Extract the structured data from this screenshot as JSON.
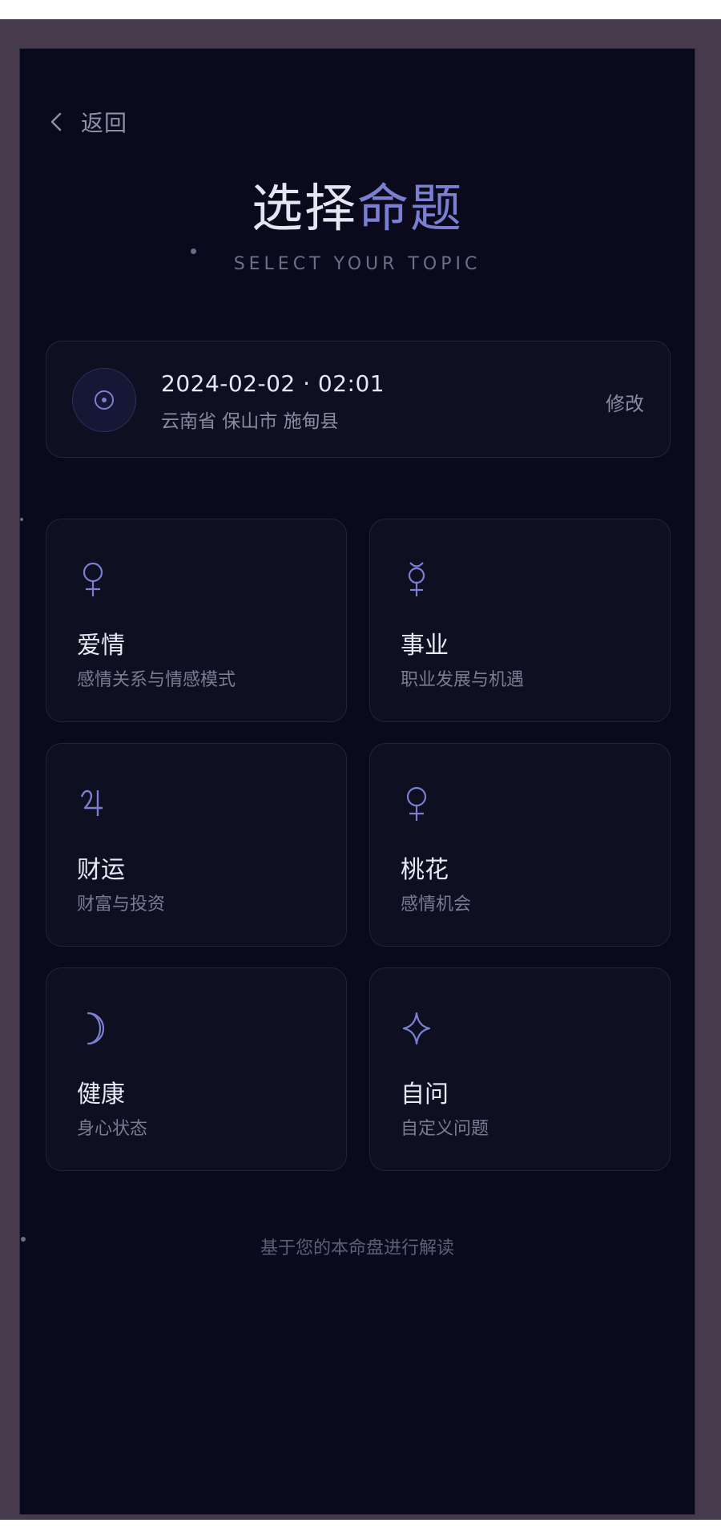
{
  "header": {
    "back_label": "返回"
  },
  "title": {
    "main": "选择",
    "accent": "命题",
    "subtitle": "SELECT YOUR TOPIC"
  },
  "birth_info": {
    "datetime": "2024-02-02 · 02:01",
    "location": "云南省 保山市 施甸县",
    "edit_label": "修改",
    "icon": "sun-symbol-icon"
  },
  "topics": [
    {
      "icon": "venus-icon",
      "title": "爱情",
      "desc": "感情关系与情感模式"
    },
    {
      "icon": "mercury-icon",
      "title": "事业",
      "desc": "职业发展与机遇"
    },
    {
      "icon": "jupiter-icon",
      "title": "财运",
      "desc": "财富与投资"
    },
    {
      "icon": "venus-icon",
      "title": "桃花",
      "desc": "感情机会"
    },
    {
      "icon": "crescent-moon-icon",
      "title": "健康",
      "desc": "身心状态"
    },
    {
      "icon": "sparkle-star-icon",
      "title": "自问",
      "desc": "自定义问题"
    }
  ],
  "footer": {
    "note": "基于您的本命盘进行解读"
  },
  "colors": {
    "background": "#0a0a1c",
    "card": "#0e0f21",
    "accent": "#7b7fd2",
    "frame": "#463a4c"
  }
}
